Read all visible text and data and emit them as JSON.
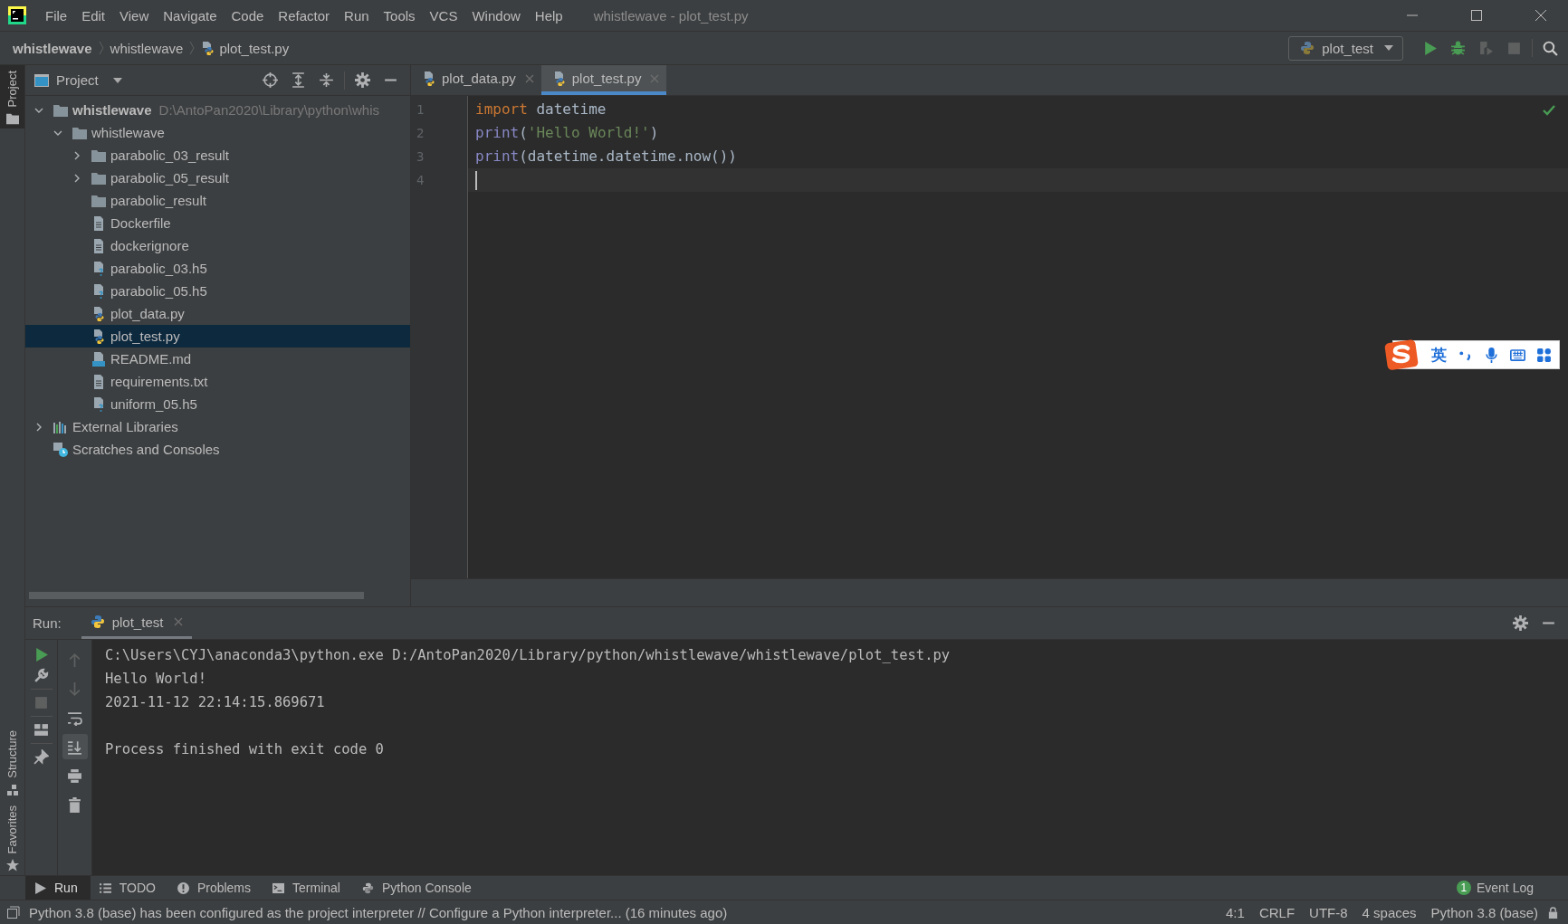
{
  "window": {
    "title": "whistlewave - plot_test.py"
  },
  "menu": [
    {
      "label": "File"
    },
    {
      "label": "Edit"
    },
    {
      "label": "View"
    },
    {
      "label": "Navigate"
    },
    {
      "label": "Code"
    },
    {
      "label": "Refactor"
    },
    {
      "label": "Run"
    },
    {
      "label": "Tools"
    },
    {
      "label": "VCS"
    },
    {
      "label": "Window"
    },
    {
      "label": "Help"
    }
  ],
  "breadcrumbs": [
    {
      "label": "whistlewave",
      "kind": "root"
    },
    {
      "label": "whistlewave",
      "kind": "folder"
    },
    {
      "label": "plot_test.py",
      "kind": "python"
    }
  ],
  "run_config": {
    "label": "plot_test"
  },
  "left_stripe": [
    {
      "label": "Project",
      "selected": true,
      "kind": "project"
    },
    {
      "label": "Structure",
      "selected": false,
      "kind": "structure"
    },
    {
      "label": "Favorites",
      "selected": false,
      "kind": "favorites"
    }
  ],
  "project_panel": {
    "title": "Project",
    "tree": [
      {
        "label": "whistlewave",
        "path": "D:\\AntoPan2020\\Library\\python\\whis",
        "kind": "folder",
        "expanded": true,
        "selected": false,
        "children": [
          {
            "label": "whistlewave",
            "kind": "folder",
            "expanded": true,
            "selected": false,
            "children": [
              {
                "label": "parabolic_03_result",
                "kind": "folder",
                "expanded": false,
                "selected": false
              },
              {
                "label": "parabolic_05_result",
                "kind": "folder",
                "expanded": false,
                "selected": false
              },
              {
                "label": "parabolic_result",
                "kind": "folder",
                "selected": false
              },
              {
                "label": "Dockerfile",
                "kind": "text",
                "selected": false
              },
              {
                "label": "dockerignore",
                "kind": "text",
                "selected": false
              },
              {
                "label": "parabolic_03.h5",
                "kind": "unknown",
                "selected": false
              },
              {
                "label": "parabolic_05.h5",
                "kind": "unknown",
                "selected": false
              },
              {
                "label": "plot_data.py",
                "kind": "python",
                "selected": false
              },
              {
                "label": "plot_test.py",
                "kind": "python",
                "selected": true
              },
              {
                "label": "README.md",
                "kind": "markdown",
                "selected": false
              },
              {
                "label": "requirements.txt",
                "kind": "text",
                "selected": false
              },
              {
                "label": "uniform_05.h5",
                "kind": "unknown",
                "selected": false
              }
            ]
          }
        ]
      },
      {
        "label": "External Libraries",
        "kind": "library",
        "expanded": false,
        "selected": false
      },
      {
        "label": "Scratches and Consoles",
        "kind": "scratches",
        "selected": false
      }
    ]
  },
  "editor": {
    "tabs": [
      {
        "label": "plot_data.py",
        "selected": false
      },
      {
        "label": "plot_test.py",
        "selected": true
      }
    ],
    "lines": [
      {
        "number": "1",
        "caret": false,
        "tokens": [
          {
            "text": "import",
            "kind": "keyword"
          },
          {
            "text": " datetime",
            "kind": "plain"
          }
        ]
      },
      {
        "number": "2",
        "caret": false,
        "tokens": [
          {
            "text": "print",
            "kind": "builtin"
          },
          {
            "text": "(",
            "kind": "plain"
          },
          {
            "text": "'Hello World!'",
            "kind": "string"
          },
          {
            "text": ")",
            "kind": "plain"
          }
        ]
      },
      {
        "number": "3",
        "caret": false,
        "tokens": [
          {
            "text": "print",
            "kind": "builtin"
          },
          {
            "text": "(datetime.datetime.now())",
            "kind": "plain"
          }
        ]
      },
      {
        "number": "4",
        "caret": true
      }
    ]
  },
  "ime": {
    "mode": "英"
  },
  "run_panel": {
    "label": "Run:",
    "tabs": [
      {
        "label": "plot_test",
        "selected": true
      }
    ],
    "toolbar_1": [
      {
        "kind": "run",
        "disabled": false
      },
      {
        "kind": "wrench",
        "disabled": false
      },
      {
        "kind": "stop",
        "disabled": true
      },
      {
        "kind": "layout",
        "disabled": false
      },
      {
        "kind": "pin",
        "disabled": false
      }
    ],
    "toolbar_2": [
      {
        "kind": "up",
        "disabled": true,
        "on": false
      },
      {
        "kind": "down",
        "disabled": true,
        "on": false
      },
      {
        "kind": "wrap",
        "disabled": false,
        "on": false
      },
      {
        "kind": "scroll_end",
        "disabled": false,
        "on": true
      },
      {
        "kind": "print",
        "disabled": false,
        "on": false
      },
      {
        "kind": "trash",
        "disabled": false,
        "on": false
      }
    ],
    "output_blocks": [
      [
        "C:\\Users\\CYJ\\anaconda3\\python.exe D:/AntoPan2020/Library/python/whistlewave/whistlewave/plot_test.py",
        "Hello World!",
        "2021-11-12 22:14:15.869671"
      ],
      [
        "Process finished with exit code 0"
      ]
    ]
  },
  "tool_buttons": [
    {
      "label": "Run",
      "kind": "run",
      "selected": true
    },
    {
      "label": "TODO",
      "kind": "todo",
      "selected": false
    },
    {
      "label": "Problems",
      "kind": "problems",
      "selected": false
    },
    {
      "label": "Terminal",
      "kind": "terminal",
      "selected": false
    },
    {
      "label": "Python Console",
      "kind": "python_console",
      "selected": false
    }
  ],
  "event_log": {
    "count": "1",
    "label": "Event Log"
  },
  "status_bar": {
    "message": "Python 3.8 (base) has been configured as the project interpreter // Configure a Python interpreter... (16 minutes ago)",
    "items": [
      "4:1",
      "CRLF",
      "UTF-8",
      "4 spaces",
      "Python 3.8 (base)"
    ]
  }
}
